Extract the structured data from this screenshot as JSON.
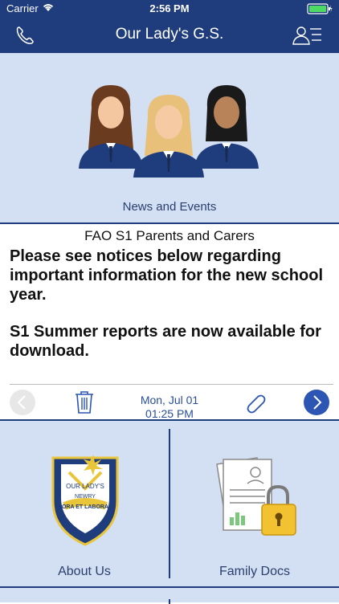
{
  "status": {
    "carrier": "Carrier",
    "time": "2:56 PM"
  },
  "navbar": {
    "title": "Our Lady's G.S."
  },
  "news": {
    "label": "News and Events"
  },
  "message": {
    "heading": "FAO S1 Parents and Carers",
    "paragraph1": "Please see notices below regarding important information for the new school year.",
    "paragraph2": "S1 Summer reports are now available for download."
  },
  "toolbar": {
    "date": "Mon, Jul 01",
    "time": "01:25 PM"
  },
  "tiles": {
    "about": {
      "label": "About Us",
      "crest_text_top": "OUR LADY'S",
      "crest_text_mid": "NEWRY",
      "crest_text_bottom": "ORA ET LABORA"
    },
    "docs": {
      "label": "Family Docs"
    }
  },
  "colors": {
    "brand": "#1f3c7c",
    "panel": "#d3dff3",
    "accent": "#2d55b3"
  }
}
